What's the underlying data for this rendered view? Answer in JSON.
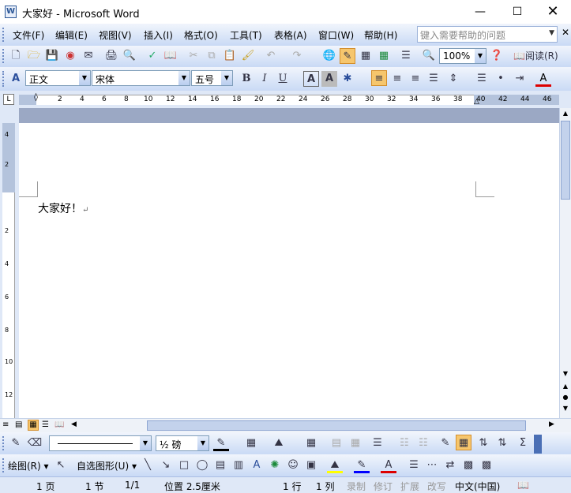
{
  "window": {
    "title": "大家好 - Microsoft Word"
  },
  "menu": {
    "items": [
      "文件(F)",
      "编辑(E)",
      "视图(V)",
      "插入(I)",
      "格式(O)",
      "工具(T)",
      "表格(A)",
      "窗口(W)",
      "帮助(H)"
    ],
    "help_placeholder": "键入需要帮助的问题"
  },
  "toolbar": {
    "zoom": "100%",
    "read_label": "阅读(R)"
  },
  "format": {
    "style": "正文",
    "font": "宋体",
    "size": "五号"
  },
  "ruler": {
    "ticks": [
      "2",
      "4",
      "6",
      "8",
      "10",
      "12",
      "14",
      "16",
      "18",
      "20",
      "22",
      "24",
      "26",
      "28",
      "30",
      "32",
      "34",
      "36",
      "38",
      "40",
      "42",
      "44",
      "46"
    ]
  },
  "vruler": {
    "ticks": [
      "4",
      "2",
      "2",
      "4",
      "6",
      "8",
      "10",
      "12"
    ]
  },
  "document": {
    "text": "大家好！",
    "para_mark": "↵"
  },
  "drawing": {
    "draw_label": "绘图(R)",
    "autoshape_label": "自选图形(U)",
    "line_weight": "½ 磅"
  },
  "status": {
    "page": "1 页",
    "section": "1 节",
    "pages": "1/1",
    "position": "位置 2.5厘米",
    "line": "1 行",
    "column": "1 列",
    "rec": "录制",
    "trk": "修订",
    "ext": "扩展",
    "ovr": "改写",
    "lang": "中文(中国)"
  },
  "icons": [
    "word-app-icon",
    "minimize-icon",
    "maximize-icon",
    "close-icon",
    "new-icon",
    "open-icon",
    "save-icon",
    "print-icon",
    "preview-icon",
    "spell-icon",
    "cut-icon",
    "copy-icon",
    "paste-icon",
    "format-painter-icon",
    "undo-icon",
    "redo-icon",
    "hyperlink-icon",
    "table-icon",
    "help-icon",
    "bold-icon",
    "italic-icon",
    "underline-icon",
    "align-left-icon",
    "align-center-icon",
    "align-right-icon",
    "justify-icon",
    "numbering-icon",
    "bullets-icon",
    "font-color-icon",
    "line-icon",
    "arrow-icon",
    "rectangle-icon",
    "oval-icon",
    "fill-color-icon",
    "line-color-icon",
    "shadow-icon"
  ]
}
